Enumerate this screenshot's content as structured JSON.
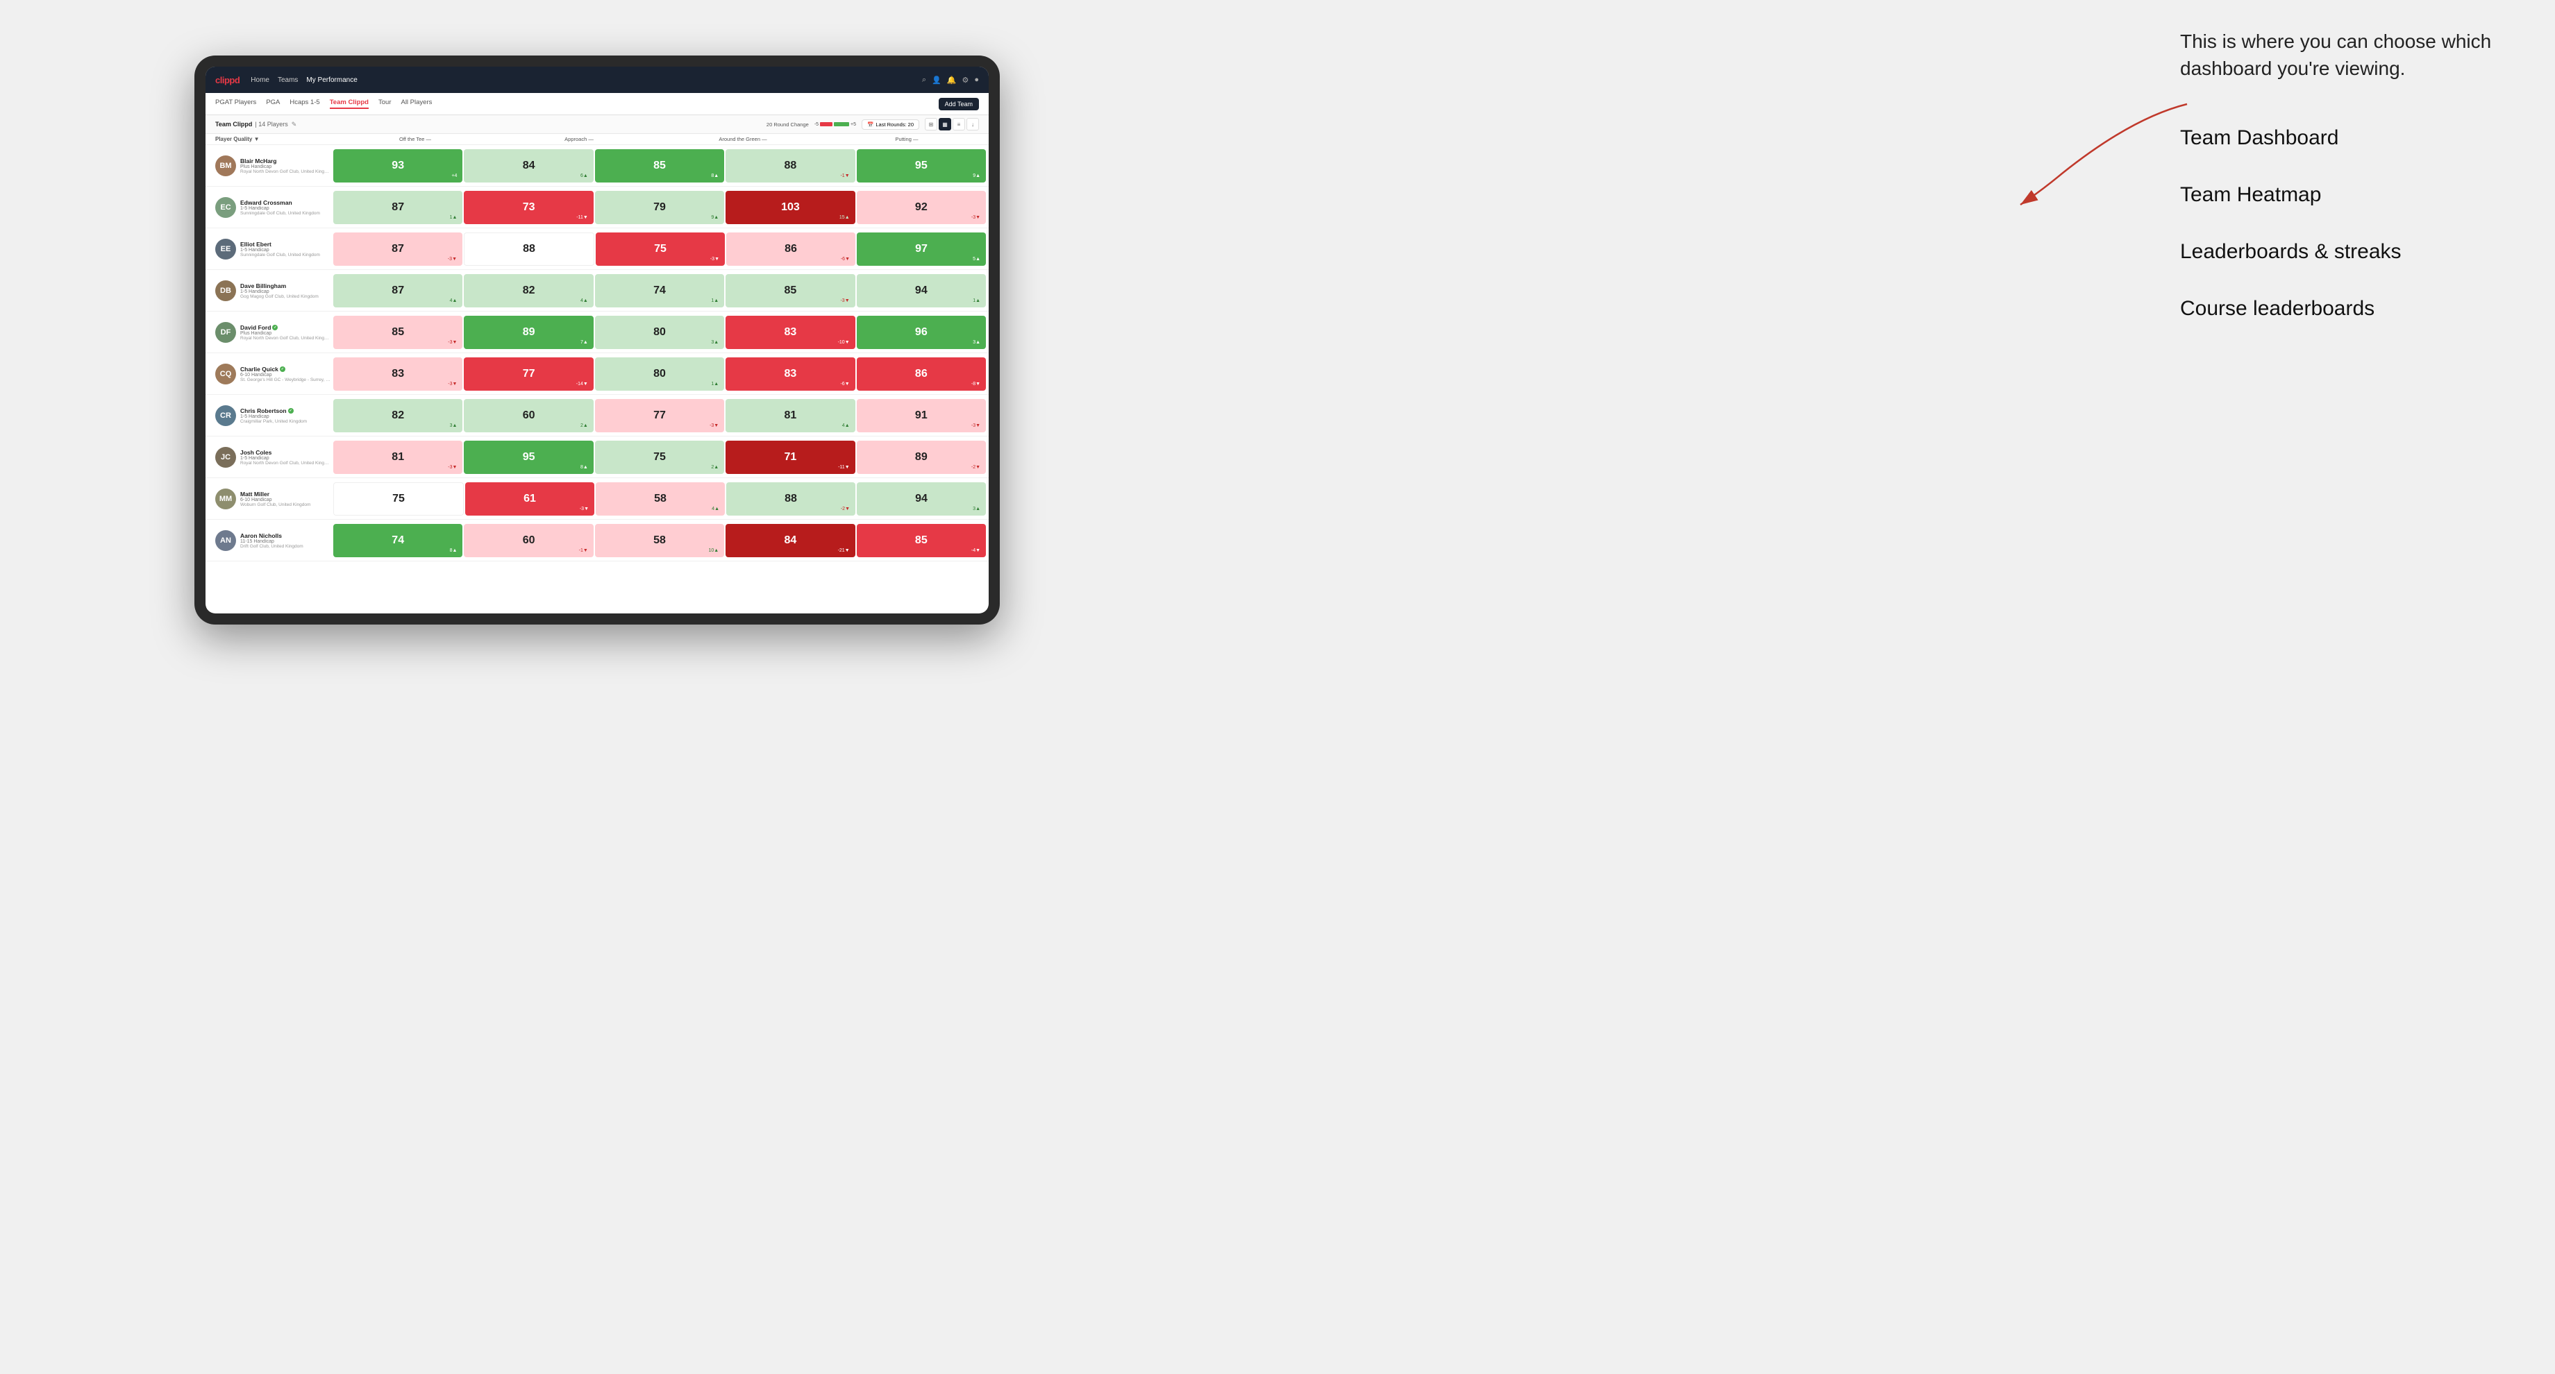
{
  "annotation": {
    "intro_text": "This is where you can choose which dashboard you're viewing.",
    "items": [
      "Team Dashboard",
      "Team Heatmap",
      "Leaderboards & streaks",
      "Course leaderboards"
    ]
  },
  "nav": {
    "logo": "clippd",
    "links": [
      "Home",
      "Teams",
      "My Performance"
    ],
    "active_link": "My Performance"
  },
  "sub_nav": {
    "links": [
      "PGAT Players",
      "PGA",
      "Hcaps 1-5",
      "Team Clippd",
      "Tour",
      "All Players"
    ],
    "active_link": "Team Clippd",
    "add_team_label": "Add Team"
  },
  "team_bar": {
    "name": "Team Clippd",
    "count": "14 Players",
    "round_change_label": "20 Round Change",
    "neg_val": "-5",
    "pos_val": "+5",
    "last_rounds_label": "Last Rounds: 20"
  },
  "column_headers": {
    "player": "Player Quality ▼",
    "off_tee": "Off the Tee —",
    "approach": "Approach —",
    "around_green": "Around the Green —",
    "putting": "Putting —"
  },
  "players": [
    {
      "name": "Blair McHarg",
      "handicap": "Plus Handicap",
      "club": "Royal North Devon Golf Club, United Kingdom",
      "initials": "BM",
      "avatar_color": "#a0785a",
      "stats": [
        {
          "value": 93,
          "change": "+4",
          "dir": "up",
          "color": "green"
        },
        {
          "value": 84,
          "change": "6▲",
          "dir": "up",
          "color": "light-green"
        },
        {
          "value": 85,
          "change": "8▲",
          "dir": "up",
          "color": "green"
        },
        {
          "value": 88,
          "change": "-1▼",
          "dir": "down",
          "color": "light-green"
        },
        {
          "value": 95,
          "change": "9▲",
          "dir": "up",
          "color": "green"
        }
      ]
    },
    {
      "name": "Edward Crossman",
      "handicap": "1-5 Handicap",
      "club": "Sunningdale Golf Club, United Kingdom",
      "initials": "EC",
      "avatar_color": "#7a9e7e",
      "stats": [
        {
          "value": 87,
          "change": "1▲",
          "dir": "up",
          "color": "light-green"
        },
        {
          "value": 73,
          "change": "-11▼",
          "dir": "down",
          "color": "red"
        },
        {
          "value": 79,
          "change": "9▲",
          "dir": "up",
          "color": "light-green"
        },
        {
          "value": 103,
          "change": "15▲",
          "dir": "up",
          "color": "dark-red"
        },
        {
          "value": 92,
          "change": "-3▼",
          "dir": "down",
          "color": "light-red"
        }
      ]
    },
    {
      "name": "Elliot Ebert",
      "handicap": "1-5 Handicap",
      "club": "Sunningdale Golf Club, United Kingdom",
      "initials": "EE",
      "avatar_color": "#5c6b7a",
      "stats": [
        {
          "value": 87,
          "change": "-3▼",
          "dir": "down",
          "color": "light-red"
        },
        {
          "value": 88,
          "change": "",
          "dir": "",
          "color": "white"
        },
        {
          "value": 75,
          "change": "-3▼",
          "dir": "down",
          "color": "red"
        },
        {
          "value": 86,
          "change": "-6▼",
          "dir": "down",
          "color": "light-red"
        },
        {
          "value": 97,
          "change": "5▲",
          "dir": "up",
          "color": "green"
        }
      ]
    },
    {
      "name": "Dave Billingham",
      "handicap": "1-5 Handicap",
      "club": "Gog Magog Golf Club, United Kingdom",
      "initials": "DB",
      "avatar_color": "#8b7355",
      "stats": [
        {
          "value": 87,
          "change": "4▲",
          "dir": "up",
          "color": "light-green"
        },
        {
          "value": 82,
          "change": "4▲",
          "dir": "up",
          "color": "light-green"
        },
        {
          "value": 74,
          "change": "1▲",
          "dir": "up",
          "color": "light-green"
        },
        {
          "value": 85,
          "change": "-3▼",
          "dir": "down",
          "color": "light-green"
        },
        {
          "value": 94,
          "change": "1▲",
          "dir": "up",
          "color": "light-green"
        }
      ]
    },
    {
      "name": "David Ford",
      "verified": true,
      "handicap": "Plus Handicap",
      "club": "Royal North Devon Golf Club, United Kingdom",
      "initials": "DF",
      "avatar_color": "#6b8e6b",
      "stats": [
        {
          "value": 85,
          "change": "-3▼",
          "dir": "down",
          "color": "light-red"
        },
        {
          "value": 89,
          "change": "7▲",
          "dir": "up",
          "color": "green"
        },
        {
          "value": 80,
          "change": "3▲",
          "dir": "up",
          "color": "light-green"
        },
        {
          "value": 83,
          "change": "-10▼",
          "dir": "down",
          "color": "red"
        },
        {
          "value": 96,
          "change": "3▲",
          "dir": "up",
          "color": "green"
        }
      ]
    },
    {
      "name": "Charlie Quick",
      "verified": true,
      "handicap": "6-10 Handicap",
      "club": "St. George's Hill GC - Weybridge - Surrey, Uni...",
      "initials": "CQ",
      "avatar_color": "#9e7a5a",
      "stats": [
        {
          "value": 83,
          "change": "-3▼",
          "dir": "down",
          "color": "light-red"
        },
        {
          "value": 77,
          "change": "-14▼",
          "dir": "down",
          "color": "red"
        },
        {
          "value": 80,
          "change": "1▲",
          "dir": "up",
          "color": "light-green"
        },
        {
          "value": 83,
          "change": "-6▼",
          "dir": "down",
          "color": "red"
        },
        {
          "value": 86,
          "change": "-8▼",
          "dir": "down",
          "color": "red"
        }
      ]
    },
    {
      "name": "Chris Robertson",
      "verified": true,
      "handicap": "1-5 Handicap",
      "club": "Craigmillar Park, United Kingdom",
      "initials": "CR",
      "avatar_color": "#5a7a8e",
      "stats": [
        {
          "value": 82,
          "change": "3▲",
          "dir": "up",
          "color": "light-green"
        },
        {
          "value": 60,
          "change": "2▲",
          "dir": "up",
          "color": "light-green"
        },
        {
          "value": 77,
          "change": "-3▼",
          "dir": "down",
          "color": "light-red"
        },
        {
          "value": 81,
          "change": "4▲",
          "dir": "up",
          "color": "light-green"
        },
        {
          "value": 91,
          "change": "-3▼",
          "dir": "down",
          "color": "light-red"
        }
      ]
    },
    {
      "name": "Josh Coles",
      "handicap": "1-5 Handicap",
      "club": "Royal North Devon Golf Club, United Kingdom",
      "initials": "JC",
      "avatar_color": "#7a6e5a",
      "stats": [
        {
          "value": 81,
          "change": "-3▼",
          "dir": "down",
          "color": "light-red"
        },
        {
          "value": 95,
          "change": "8▲",
          "dir": "up",
          "color": "green"
        },
        {
          "value": 75,
          "change": "2▲",
          "dir": "up",
          "color": "light-green"
        },
        {
          "value": 71,
          "change": "-11▼",
          "dir": "down",
          "color": "dark-red"
        },
        {
          "value": 89,
          "change": "-2▼",
          "dir": "down",
          "color": "light-red"
        }
      ]
    },
    {
      "name": "Matt Miller",
      "handicap": "6-10 Handicap",
      "club": "Woburn Golf Club, United Kingdom",
      "initials": "MM",
      "avatar_color": "#8e8e6e",
      "stats": [
        {
          "value": 75,
          "change": "",
          "dir": "",
          "color": "white"
        },
        {
          "value": 61,
          "change": "-3▼",
          "dir": "down",
          "color": "red"
        },
        {
          "value": 58,
          "change": "4▲",
          "dir": "up",
          "color": "light-red"
        },
        {
          "value": 88,
          "change": "-2▼",
          "dir": "down",
          "color": "light-green"
        },
        {
          "value": 94,
          "change": "3▲",
          "dir": "up",
          "color": "light-green"
        }
      ]
    },
    {
      "name": "Aaron Nicholls",
      "handicap": "11-15 Handicap",
      "club": "Drift Golf Club, United Kingdom",
      "initials": "AN",
      "avatar_color": "#6e7a8e",
      "stats": [
        {
          "value": 74,
          "change": "8▲",
          "dir": "up",
          "color": "green"
        },
        {
          "value": 60,
          "change": "-1▼",
          "dir": "down",
          "color": "light-red"
        },
        {
          "value": 58,
          "change": "10▲",
          "dir": "up",
          "color": "light-red"
        },
        {
          "value": 84,
          "change": "-21▼",
          "dir": "down",
          "color": "dark-red"
        },
        {
          "value": 85,
          "change": "-4▼",
          "dir": "down",
          "color": "red"
        }
      ]
    }
  ]
}
